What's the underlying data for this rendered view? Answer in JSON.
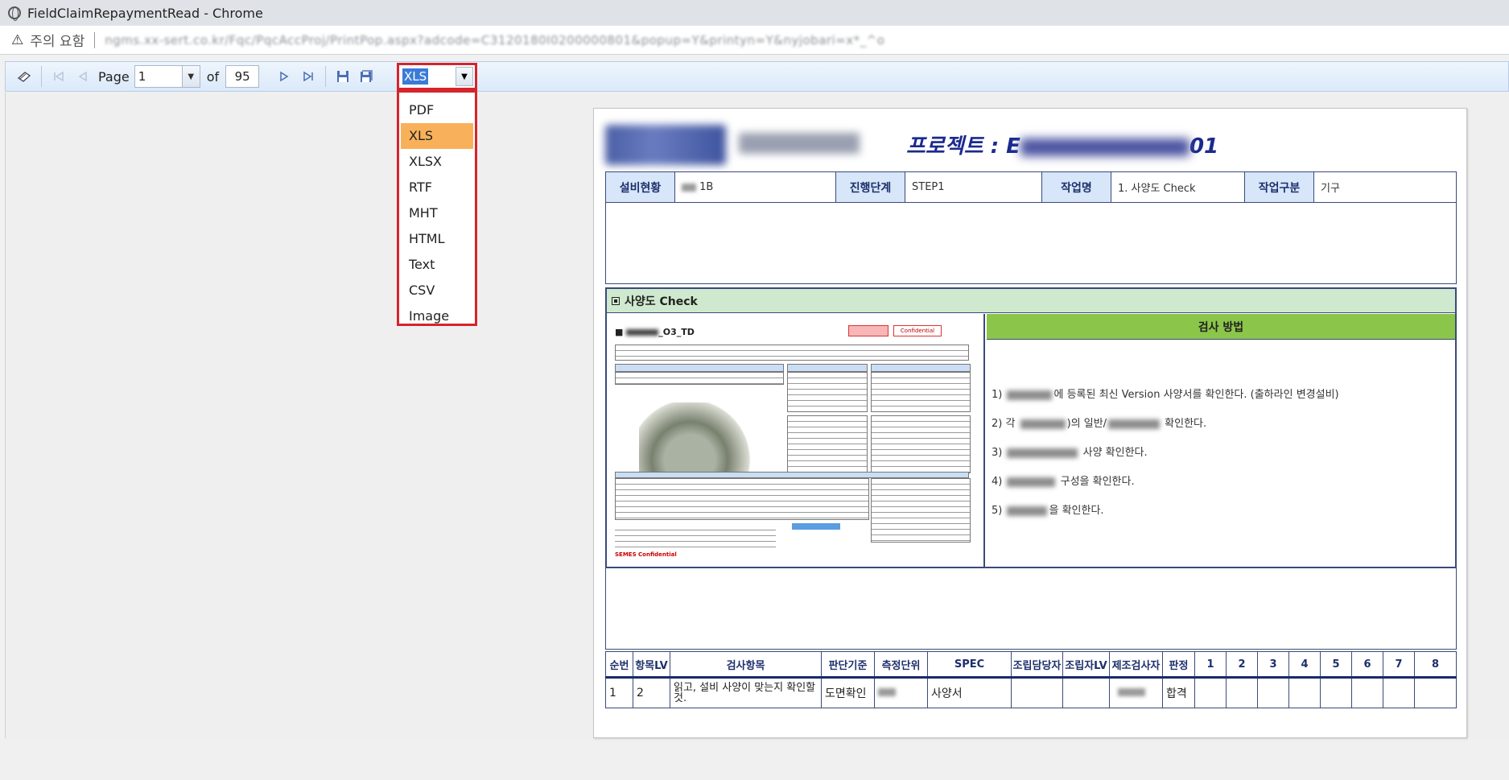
{
  "window": {
    "title": "FieldClaimRepaymentRead - Chrome"
  },
  "address_bar": {
    "warning": "주의 요함",
    "url": "ngms.xx-sert.co.kr/Fqc/PqcAccProj/PrintPop.aspx?adcode=C3120180I0200000801&popup=Y&printyn=Y&nyjobari=x*_^o"
  },
  "toolbar": {
    "page_label": "Page",
    "page_value": "1",
    "of_label": "of",
    "total_pages": "95",
    "format_value": "XLS"
  },
  "format_dropdown": {
    "options": [
      "PDF",
      "XLS",
      "XLSX",
      "RTF",
      "MHT",
      "HTML",
      "Text",
      "CSV",
      "Image"
    ],
    "selected": "XLS"
  },
  "report": {
    "project_prefix": "프로젝트 : E",
    "project_suffix": "01",
    "info": {
      "equip_label": "설비현황",
      "equip_value": "1B",
      "stage_label": "진행단계",
      "stage_value": "STEP1",
      "job_label": "작업명",
      "job_value": "1. 사양도 Check",
      "type_label": "작업구분",
      "type_value": "기구"
    },
    "section_title": "사양도 Check",
    "thumbnail": {
      "title": "_O3_TD",
      "confidential": "Confidential",
      "footer": "SEMES Confidential"
    },
    "method_title": "검사 방법",
    "method_lines": [
      {
        "prefix": "1) ",
        "text": "에 등록된 최신 Version 사양서를 확인한다. (출하라인 변경설비)"
      },
      {
        "prefix": "2) 각 ",
        "text": ")의 일반/",
        "suffix": " 확인한다."
      },
      {
        "prefix": "3) ",
        "text": " 사양 확인한다."
      },
      {
        "prefix": "4) ",
        "text": " 구성을 확인한다."
      },
      {
        "prefix": "5) ",
        "text": "을 확인한다."
      }
    ],
    "result_headers": [
      "순번",
      "항목LV",
      "검사항목",
      "판단기준",
      "측정단위",
      "SPEC",
      "조립담당자",
      "조립자LV",
      "제조검사자",
      "판정",
      "1",
      "2",
      "3",
      "4",
      "5",
      "6",
      "7",
      "8"
    ],
    "result_rows": [
      [
        "1",
        "2",
        "읽고, 설비 사양이 맞는지 확인할 것.",
        "도면확인",
        "",
        "사양서",
        "",
        "",
        "",
        "합격",
        "",
        "",
        "",
        "",
        "",
        "",
        "",
        ""
      ]
    ]
  }
}
